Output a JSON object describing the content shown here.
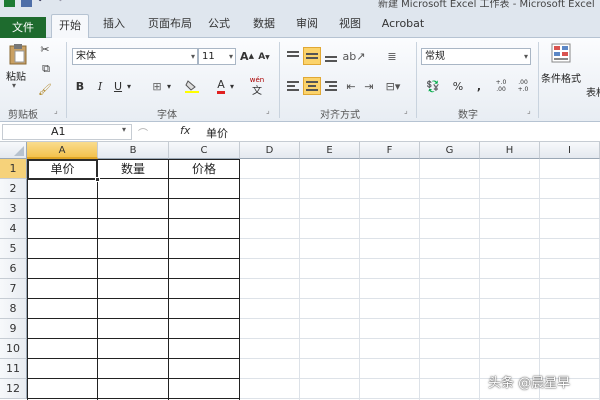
{
  "window": {
    "title": "新建 Microsoft Excel 工作表 - Microsoft Excel"
  },
  "tabs": [
    "文件",
    "开始",
    "插入",
    "页面布局",
    "公式",
    "数据",
    "审阅",
    "视图",
    "Acrobat"
  ],
  "ribbon": {
    "clipboard": {
      "paste": "粘贴",
      "label": "剪贴板"
    },
    "font": {
      "name": "宋体",
      "size": "11",
      "label": "字体",
      "bold": "B",
      "italic": "I",
      "underline": "U",
      "font_color_glyph": "A",
      "phonetic": "wén"
    },
    "alignment": {
      "label": "对齐方式"
    },
    "number": {
      "format": "常规",
      "label": "数字",
      "percent": "%",
      "comma": ",",
      "inc_decimal": "+.0 .00",
      "dec_decimal": ".00 +.0"
    },
    "styles": {
      "conditional_format": "条件格式",
      "table_format": "表格"
    }
  },
  "formula_bar": {
    "name_box": "A1",
    "fx": "fx",
    "content": "单价"
  },
  "sheet": {
    "columns": [
      "A",
      "B",
      "C",
      "D",
      "E",
      "F",
      "G",
      "H",
      "I"
    ],
    "rows": [
      "1",
      "2",
      "3",
      "4",
      "5",
      "6",
      "7",
      "8",
      "9",
      "10",
      "11",
      "12"
    ],
    "headers": [
      "单价",
      "数量",
      "价格"
    ],
    "selected_cell": "A1"
  },
  "watermark": "头条 @晨星早",
  "colors": {
    "file_tab": "#1e6b2e",
    "selection_header": "#f4c24e",
    "highlight_button": "#fbd36b"
  }
}
